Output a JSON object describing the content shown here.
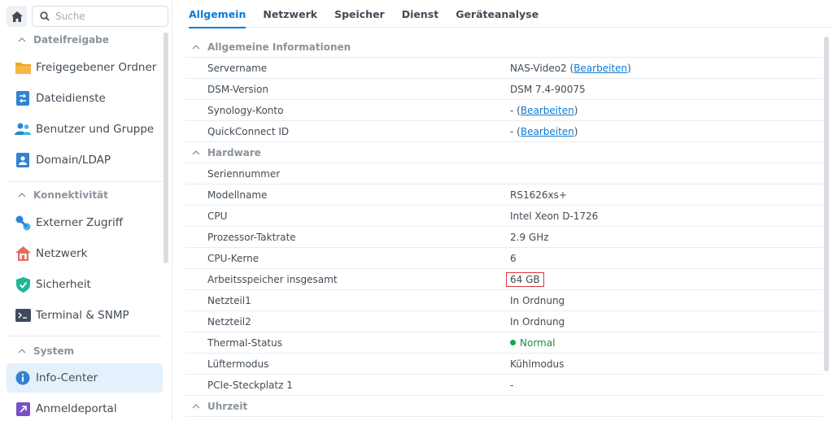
{
  "search": {
    "placeholder": "Suche"
  },
  "sidebar": {
    "sections": [
      {
        "title": "Dateifreigabe",
        "items": [
          {
            "label": "Freigegebener Ordner",
            "icon": "folder-icon"
          },
          {
            "label": "Dateidienste",
            "icon": "file-services-icon"
          },
          {
            "label": "Benutzer und Gruppe",
            "icon": "users-icon"
          },
          {
            "label": "Domain/LDAP",
            "icon": "domain-icon"
          }
        ]
      },
      {
        "title": "Konnektivität",
        "items": [
          {
            "label": "Externer Zugriff",
            "icon": "external-access-icon"
          },
          {
            "label": "Netzwerk",
            "icon": "network-house-icon"
          },
          {
            "label": "Sicherheit",
            "icon": "shield-icon"
          },
          {
            "label": "Terminal & SNMP",
            "icon": "terminal-icon"
          }
        ]
      },
      {
        "title": "System",
        "items": [
          {
            "label": "Info-Center",
            "icon": "info-icon",
            "active": true
          },
          {
            "label": "Anmeldeportal",
            "icon": "login-portal-icon"
          }
        ]
      }
    ]
  },
  "tabs": [
    "Allgemein",
    "Netzwerk",
    "Speicher",
    "Dienst",
    "Geräteanalyse"
  ],
  "groups": {
    "general": "Allgemeine Informationen",
    "hardware": "Hardware",
    "time": "Uhrzeit"
  },
  "rows": {
    "servername": {
      "key": "Servername",
      "value": "NAS-Video2",
      "open": " (",
      "link": "Bearbeiten",
      "close": ")"
    },
    "dsm": {
      "key": "DSM-Version",
      "value": "DSM 7.4-90075"
    },
    "synology": {
      "key": "Synology-Konto",
      "value": "-",
      "open": " (",
      "link": "Bearbeiten",
      "close": ")"
    },
    "quickconnect": {
      "key": "QuickConnect ID",
      "value": "-",
      "open": " (",
      "link": "Bearbeiten",
      "close": ")"
    },
    "serial": {
      "key": "Seriennummer",
      "value": ""
    },
    "model": {
      "key": "Modellname",
      "value": "RS1626xs+"
    },
    "cpu": {
      "key": "CPU",
      "value": "Intel Xeon D-1726"
    },
    "clock": {
      "key": "Prozessor-Taktrate",
      "value": "2.9 GHz"
    },
    "cores": {
      "key": "CPU-Kerne",
      "value": "6"
    },
    "memory": {
      "key": "Arbeitsspeicher insgesamt",
      "value": "64 GB"
    },
    "psu1": {
      "key": "Netzteil1",
      "value": "In Ordnung"
    },
    "psu2": {
      "key": "Netzteil2",
      "value": "In Ordnung"
    },
    "thermal": {
      "key": "Thermal-Status",
      "value": "Normal"
    },
    "fan": {
      "key": "Lüftermodus",
      "value": "Kühlmodus"
    },
    "pcie": {
      "key": "PCIe-Steckplatz 1",
      "value": "-"
    }
  },
  "colors": {
    "accent": "#0b7bd6",
    "ok": "#1aa34a",
    "highlight": "#d9383c"
  }
}
